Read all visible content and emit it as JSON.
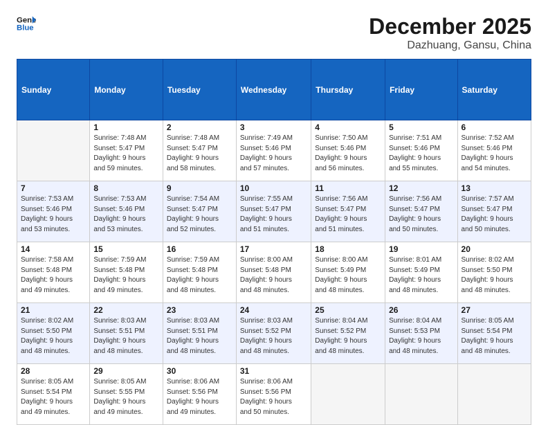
{
  "logo": {
    "line1": "General",
    "line2": "Blue"
  },
  "title": "December 2025",
  "location": "Dazhuang, Gansu, China",
  "days_of_week": [
    "Sunday",
    "Monday",
    "Tuesday",
    "Wednesday",
    "Thursday",
    "Friday",
    "Saturday"
  ],
  "weeks": [
    [
      {
        "day": "",
        "detail": ""
      },
      {
        "day": "1",
        "detail": "Sunrise: 7:48 AM\nSunset: 5:47 PM\nDaylight: 9 hours\nand 59 minutes."
      },
      {
        "day": "2",
        "detail": "Sunrise: 7:48 AM\nSunset: 5:47 PM\nDaylight: 9 hours\nand 58 minutes."
      },
      {
        "day": "3",
        "detail": "Sunrise: 7:49 AM\nSunset: 5:46 PM\nDaylight: 9 hours\nand 57 minutes."
      },
      {
        "day": "4",
        "detail": "Sunrise: 7:50 AM\nSunset: 5:46 PM\nDaylight: 9 hours\nand 56 minutes."
      },
      {
        "day": "5",
        "detail": "Sunrise: 7:51 AM\nSunset: 5:46 PM\nDaylight: 9 hours\nand 55 minutes."
      },
      {
        "day": "6",
        "detail": "Sunrise: 7:52 AM\nSunset: 5:46 PM\nDaylight: 9 hours\nand 54 minutes."
      }
    ],
    [
      {
        "day": "7",
        "detail": "Sunrise: 7:53 AM\nSunset: 5:46 PM\nDaylight: 9 hours\nand 53 minutes."
      },
      {
        "day": "8",
        "detail": "Sunrise: 7:53 AM\nSunset: 5:46 PM\nDaylight: 9 hours\nand 53 minutes."
      },
      {
        "day": "9",
        "detail": "Sunrise: 7:54 AM\nSunset: 5:47 PM\nDaylight: 9 hours\nand 52 minutes."
      },
      {
        "day": "10",
        "detail": "Sunrise: 7:55 AM\nSunset: 5:47 PM\nDaylight: 9 hours\nand 51 minutes."
      },
      {
        "day": "11",
        "detail": "Sunrise: 7:56 AM\nSunset: 5:47 PM\nDaylight: 9 hours\nand 51 minutes."
      },
      {
        "day": "12",
        "detail": "Sunrise: 7:56 AM\nSunset: 5:47 PM\nDaylight: 9 hours\nand 50 minutes."
      },
      {
        "day": "13",
        "detail": "Sunrise: 7:57 AM\nSunset: 5:47 PM\nDaylight: 9 hours\nand 50 minutes."
      }
    ],
    [
      {
        "day": "14",
        "detail": "Sunrise: 7:58 AM\nSunset: 5:48 PM\nDaylight: 9 hours\nand 49 minutes."
      },
      {
        "day": "15",
        "detail": "Sunrise: 7:59 AM\nSunset: 5:48 PM\nDaylight: 9 hours\nand 49 minutes."
      },
      {
        "day": "16",
        "detail": "Sunrise: 7:59 AM\nSunset: 5:48 PM\nDaylight: 9 hours\nand 48 minutes."
      },
      {
        "day": "17",
        "detail": "Sunrise: 8:00 AM\nSunset: 5:48 PM\nDaylight: 9 hours\nand 48 minutes."
      },
      {
        "day": "18",
        "detail": "Sunrise: 8:00 AM\nSunset: 5:49 PM\nDaylight: 9 hours\nand 48 minutes."
      },
      {
        "day": "19",
        "detail": "Sunrise: 8:01 AM\nSunset: 5:49 PM\nDaylight: 9 hours\nand 48 minutes."
      },
      {
        "day": "20",
        "detail": "Sunrise: 8:02 AM\nSunset: 5:50 PM\nDaylight: 9 hours\nand 48 minutes."
      }
    ],
    [
      {
        "day": "21",
        "detail": "Sunrise: 8:02 AM\nSunset: 5:50 PM\nDaylight: 9 hours\nand 48 minutes."
      },
      {
        "day": "22",
        "detail": "Sunrise: 8:03 AM\nSunset: 5:51 PM\nDaylight: 9 hours\nand 48 minutes."
      },
      {
        "day": "23",
        "detail": "Sunrise: 8:03 AM\nSunset: 5:51 PM\nDaylight: 9 hours\nand 48 minutes."
      },
      {
        "day": "24",
        "detail": "Sunrise: 8:03 AM\nSunset: 5:52 PM\nDaylight: 9 hours\nand 48 minutes."
      },
      {
        "day": "25",
        "detail": "Sunrise: 8:04 AM\nSunset: 5:52 PM\nDaylight: 9 hours\nand 48 minutes."
      },
      {
        "day": "26",
        "detail": "Sunrise: 8:04 AM\nSunset: 5:53 PM\nDaylight: 9 hours\nand 48 minutes."
      },
      {
        "day": "27",
        "detail": "Sunrise: 8:05 AM\nSunset: 5:54 PM\nDaylight: 9 hours\nand 48 minutes."
      }
    ],
    [
      {
        "day": "28",
        "detail": "Sunrise: 8:05 AM\nSunset: 5:54 PM\nDaylight: 9 hours\nand 49 minutes."
      },
      {
        "day": "29",
        "detail": "Sunrise: 8:05 AM\nSunset: 5:55 PM\nDaylight: 9 hours\nand 49 minutes."
      },
      {
        "day": "30",
        "detail": "Sunrise: 8:06 AM\nSunset: 5:56 PM\nDaylight: 9 hours\nand 49 minutes."
      },
      {
        "day": "31",
        "detail": "Sunrise: 8:06 AM\nSunset: 5:56 PM\nDaylight: 9 hours\nand 50 minutes."
      },
      {
        "day": "",
        "detail": ""
      },
      {
        "day": "",
        "detail": ""
      },
      {
        "day": "",
        "detail": ""
      }
    ]
  ]
}
